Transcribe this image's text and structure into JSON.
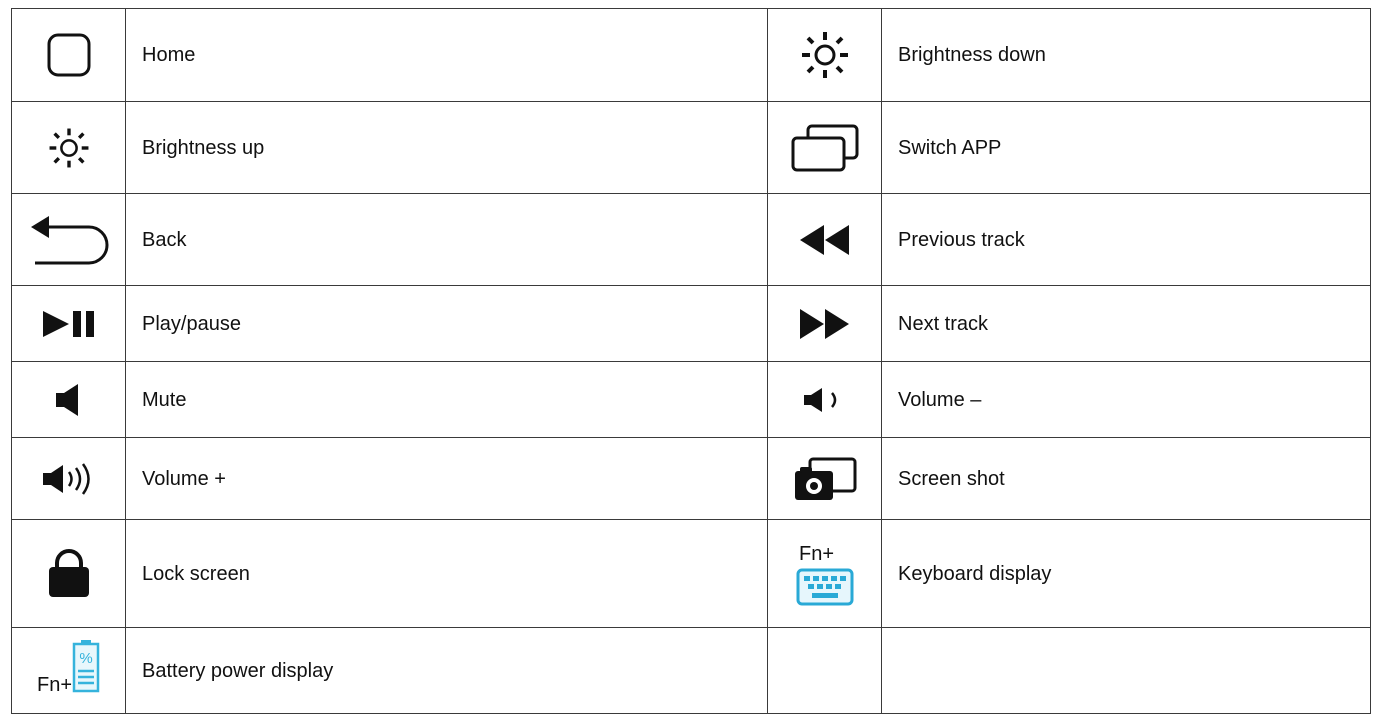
{
  "rows": [
    {
      "left": {
        "icon": "home-square-icon",
        "label": "Home"
      },
      "right": {
        "icon": "brightness-down-icon",
        "label": "Brightness down"
      }
    },
    {
      "left": {
        "icon": "brightness-up-icon",
        "label": "Brightness up"
      },
      "right": {
        "icon": "switch-app-icon",
        "label": "Switch APP"
      }
    },
    {
      "left": {
        "icon": "back-arrow-icon",
        "label": "Back"
      },
      "right": {
        "icon": "previous-track-icon",
        "label": "Previous track"
      }
    },
    {
      "left": {
        "icon": "play-pause-icon",
        "label": "Play/pause"
      },
      "right": {
        "icon": "next-track-icon",
        "label": "Next track"
      }
    },
    {
      "left": {
        "icon": "mute-speaker-icon",
        "label": "Mute"
      },
      "right": {
        "icon": "volume-down-speaker-icon",
        "label": "Volume –"
      }
    },
    {
      "left": {
        "icon": "volume-up-speaker-icon",
        "label": "Volume +"
      },
      "right": {
        "icon": "screen-shot-camera-icon",
        "label": "Screen shot"
      }
    },
    {
      "left": {
        "icon": "lock-screen-icon",
        "label": "Lock screen"
      },
      "right": {
        "icon": "keyboard-icon",
        "prefix": "Fn+",
        "label": "Keyboard display"
      }
    },
    {
      "left": {
        "icon": "battery-percent-icon",
        "prefix": "Fn+",
        "label": "Battery power display"
      },
      "right": {
        "icon": "",
        "label": ""
      }
    }
  ],
  "colors": {
    "border": "#3a3a3a",
    "icon": "#111111",
    "keyboard_accent": "#29a9d6",
    "battery_accent": "#35b3dc"
  }
}
